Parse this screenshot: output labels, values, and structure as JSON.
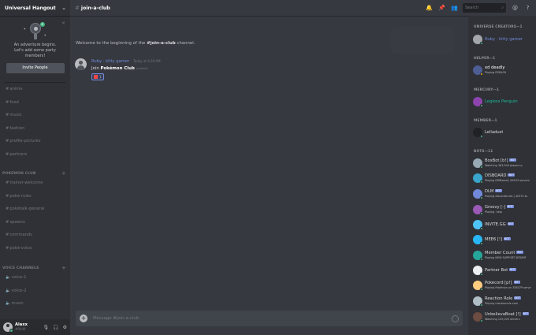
{
  "colors": {
    "accent": "#7289da",
    "online": "#43b581",
    "idle": "#faa61a",
    "dnd": "#f04747",
    "cyan": "#1abc9c"
  },
  "server": {
    "name": "Universal Hangout"
  },
  "invite": {
    "line1": "An adventure begins.",
    "line2": "Let's add some party members!",
    "button": "Invite People"
  },
  "channels": {
    "top": [
      "anime",
      "food",
      "music",
      "fashion",
      "profile-pictures",
      "partners"
    ],
    "pokemon_category": "POKEMON CLUB",
    "pokemon": [
      "trainer-welcome",
      "pokė-rules",
      "pokėtalk-general",
      "spawns",
      "commands",
      "pokė-voice"
    ],
    "voice_category": "VOICE CHANNELS",
    "voice": [
      "voice-1",
      "voice-2",
      "music"
    ]
  },
  "user": {
    "name": "Alaxx",
    "tag": "#0049"
  },
  "topbar": {
    "channel": "join-a-club",
    "search_placeholder": "Search"
  },
  "chat": {
    "welcome_prefix": "Welcome to the beginning of the ",
    "welcome_channel": "#join-a-club",
    "welcome_suffix": " channel.",
    "message": {
      "author": "Ruby · kitty gamer",
      "time": "Today at 9:26 AM",
      "text_prefix": "Join ",
      "club": "Pokémon Club",
      "edited": "(edited)",
      "reaction_count": "1"
    },
    "composer_placeholder": "Message #join-a-club"
  },
  "members": {
    "groups": [
      {
        "label": "UNIVERSE CREATORS—1",
        "items": [
          {
            "name": "Ruby · kitty gamer",
            "activity": "",
            "bot": false,
            "color": "#7289da",
            "status": "online",
            "avatar": "#a3a6aa"
          }
        ]
      },
      {
        "label": "HELPER—1",
        "items": [
          {
            "name": "xd deadly",
            "activity": "Playing ROBLOX",
            "bot": false,
            "color": "#ffffff",
            "status": "idle",
            "avatar": "#4e5d94"
          }
        ]
      },
      {
        "label": "MERCURY—1",
        "items": [
          {
            "name": "Legless Penguin",
            "activity": "",
            "bot": false,
            "color": "#1abc9c",
            "status": "online",
            "avatar": "#8e44ad"
          }
        ]
      },
      {
        "label": "MEMBER—1",
        "items": [
          {
            "name": "Lelladust",
            "activity": "",
            "bot": false,
            "color": "#dcddde",
            "status": "online",
            "avatar": "#202225"
          }
        ]
      },
      {
        "label": "BOTS—11",
        "items": [
          {
            "name": "BoxBot [b!]",
            "activity": "Watching 363,944 players p",
            "bot": true,
            "color": "#dcddde",
            "status": "online",
            "avatar": "#99aab5"
          },
          {
            "name": "DISBOARD",
            "activity": "Playing DISBoard | 89103 servers",
            "bot": true,
            "color": "#dcddde",
            "status": "online",
            "avatar": "#3ba4cc"
          },
          {
            "name": "DLM",
            "activity": "Playing discordbl.net | 42370 se",
            "bot": true,
            "color": "#dcddde",
            "status": "online",
            "avatar": "#7289da"
          },
          {
            "name": "Groovy [-]",
            "activity": "Playing -help",
            "bot": true,
            "color": "#dcddde",
            "status": "online",
            "avatar": "#9b59b6"
          },
          {
            "name": "INVITE.GG",
            "activity": "",
            "bot": true,
            "color": "#dcddde",
            "status": "online",
            "avatar": "#4fc3f7"
          },
          {
            "name": "MEE6 [!]",
            "activity": "",
            "bot": true,
            "color": "#dcddde",
            "status": "online",
            "avatar": "#29b6f6"
          },
          {
            "name": "Member Count",
            "activity": "Playing NEW SUPPORT SERVER",
            "bot": true,
            "color": "#dcddde",
            "status": "online",
            "avatar": "#26a69a"
          },
          {
            "name": "Partner Bot",
            "activity": "",
            "bot": true,
            "color": "#dcddde",
            "status": "online",
            "avatar": "#eceff1"
          },
          {
            "name": "Pokécord [p!]",
            "activity": "Playing Pokémon on 358379 serve",
            "bot": true,
            "color": "#dcddde",
            "status": "online",
            "avatar": "#ffcc80"
          },
          {
            "name": "Reaction Role",
            "activity": "Playing reactionrole.com",
            "bot": true,
            "color": "#dcddde",
            "status": "online",
            "avatar": "#b0bec5"
          },
          {
            "name": "UnbelievaBoat [!]",
            "activity": "Watching 135,003 servers",
            "bot": true,
            "color": "#dcddde",
            "status": "online",
            "avatar": "#6d4c41"
          }
        ]
      }
    ],
    "bot_tag": "BOT"
  }
}
